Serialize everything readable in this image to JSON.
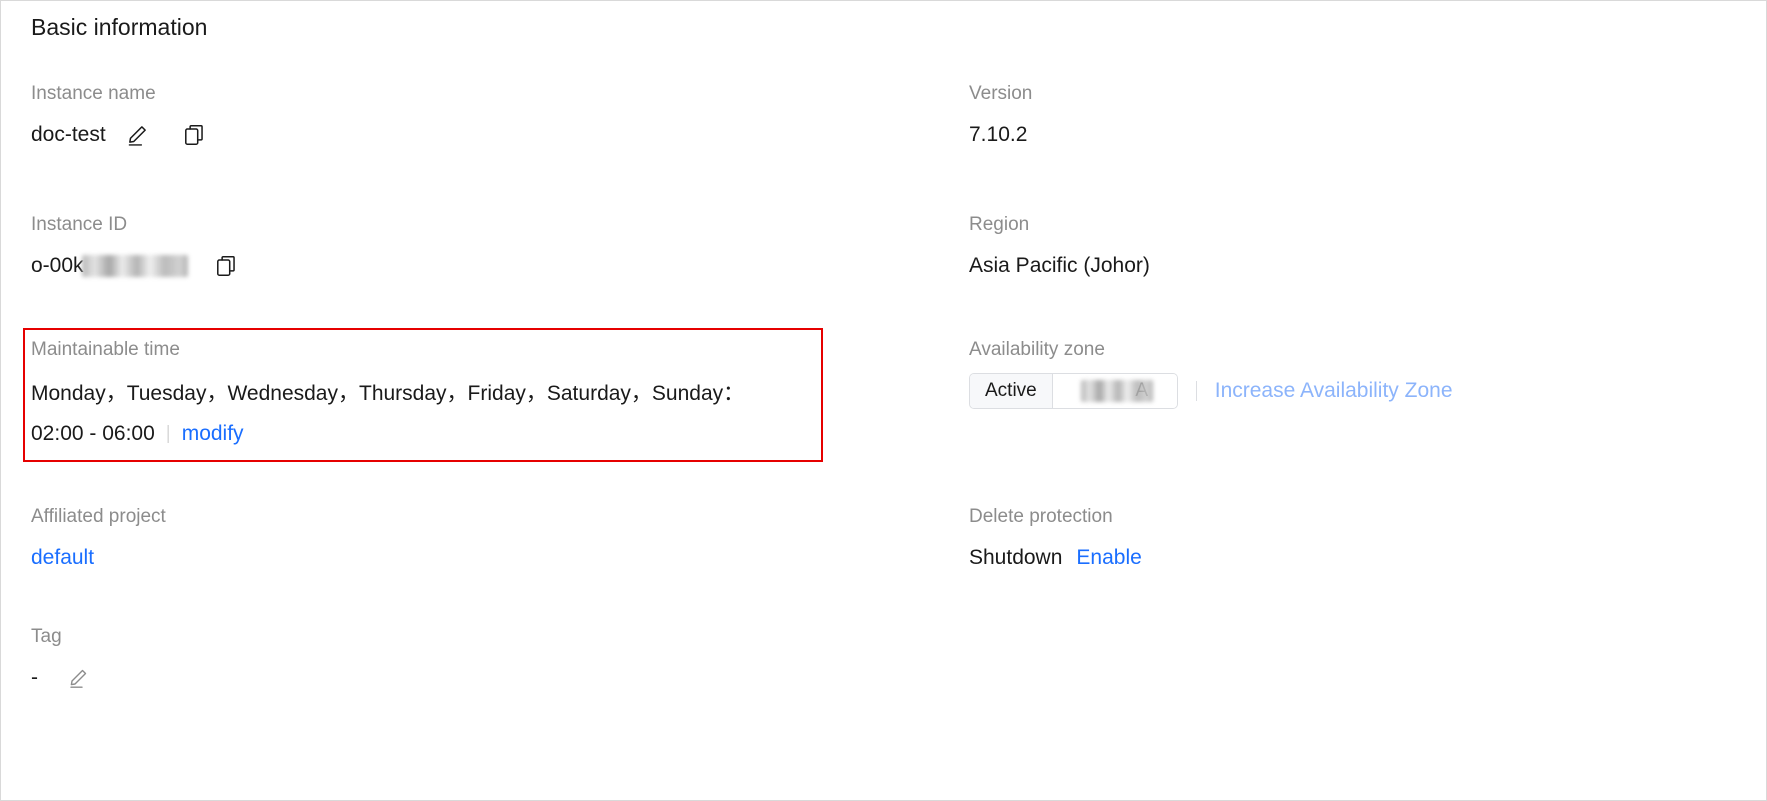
{
  "panel": {
    "title": "Basic information"
  },
  "left_column": {
    "instance_name": {
      "label": "Instance name",
      "value": "doc-test",
      "edit_icon": "pencil-icon",
      "copy_icon": "copy-icon"
    },
    "instance_id": {
      "label": "Instance ID",
      "value_prefix": "o-00k",
      "value_redacted": true,
      "copy_icon": "copy-icon"
    },
    "maintainable_time": {
      "label": "Maintainable time",
      "days": "Monday，Tuesday，Wednesday，Thursday，Friday，Saturday，Sunday：",
      "time_range": "02:00 - 06:00",
      "modify_link": "modify",
      "highlighted": true,
      "highlight_color": "#e60000"
    },
    "affiliated_project": {
      "label": "Affiliated project",
      "value": "default"
    },
    "tag": {
      "label": "Tag",
      "value": "-",
      "edit_icon": "pencil-icon"
    }
  },
  "right_column": {
    "version": {
      "label": "Version",
      "value": "7.10.2"
    },
    "region": {
      "label": "Region",
      "value": "Asia Pacific (Johor)"
    },
    "availability_zone": {
      "label": "Availability zone",
      "state": "Active",
      "zone_name_suffix": "A",
      "zone_name_redacted": true,
      "increase_link": "Increase Availability Zone"
    },
    "delete_protection": {
      "label": "Delete protection",
      "value": "Shutdown",
      "action_link": "Enable"
    }
  },
  "colors": {
    "link": "#1a6eff",
    "link_muted": "#8cb4fb",
    "label": "#8c8c8c",
    "text": "#1a1a1a",
    "highlight": "#e60000"
  }
}
